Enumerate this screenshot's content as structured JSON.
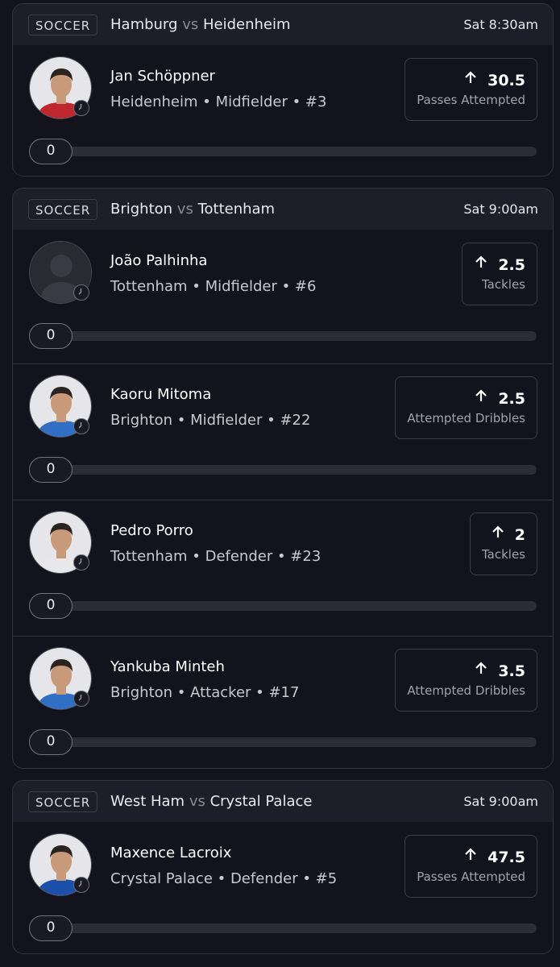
{
  "games": [
    {
      "sport": "SOCCER",
      "home": "Hamburg",
      "vs": "vs",
      "away": "Heidenheim",
      "time": "Sat 8:30am",
      "players": [
        {
          "name": "Jan Schöppner",
          "team": "Heidenheim",
          "position": "Midfielder",
          "number": "#3",
          "meta": "Heidenheim • Midfielder • #3",
          "line": "30.5",
          "stat": "Passes Attempted",
          "count": "0",
          "progress": 0,
          "jersey": "#c0262d",
          "photo": "player-photo"
        }
      ]
    },
    {
      "sport": "SOCCER",
      "home": "Brighton",
      "vs": "vs",
      "away": "Tottenham",
      "time": "Sat 9:00am",
      "players": [
        {
          "name": "João Palhinha",
          "team": "Tottenham",
          "position": "Midfielder",
          "number": "#6",
          "meta": "Tottenham • Midfielder • #6",
          "line": "2.5",
          "stat": "Tackles",
          "count": "0",
          "progress": 0,
          "jersey": "#2a2a33",
          "photo": "silhouette-placeholder"
        },
        {
          "name": "Kaoru Mitoma",
          "team": "Brighton",
          "position": "Midfielder",
          "number": "#22",
          "meta": "Brighton • Midfielder • #22",
          "line": "2.5",
          "stat": "Attempted Dribbles",
          "count": "0",
          "progress": 0,
          "jersey": "#2f6fc4",
          "photo": "player-photo"
        },
        {
          "name": "Pedro Porro",
          "team": "Tottenham",
          "position": "Defender",
          "number": "#23",
          "meta": "Tottenham • Defender • #23",
          "line": "2",
          "stat": "Tackles",
          "count": "0",
          "progress": 0,
          "jersey": "#e8e8ea",
          "photo": "player-photo"
        },
        {
          "name": "Yankuba Minteh",
          "team": "Brighton",
          "position": "Attacker",
          "number": "#17",
          "meta": "Brighton • Attacker • #17",
          "line": "3.5",
          "stat": "Attempted Dribbles",
          "count": "0",
          "progress": 0,
          "jersey": "#2f6fc4",
          "photo": "player-photo"
        }
      ]
    },
    {
      "sport": "SOCCER",
      "home": "West Ham",
      "vs": "vs",
      "away": "Crystal Palace",
      "time": "Sat 9:00am",
      "players": [
        {
          "name": "Maxence Lacroix",
          "team": "Crystal Palace",
          "position": "Defender",
          "number": "#5",
          "meta": "Crystal Palace • Defender • #5",
          "line": "47.5",
          "stat": "Passes Attempted",
          "count": "0",
          "progress": 0,
          "jersey": "#1b4fa8",
          "photo": "player-photo"
        }
      ]
    }
  ],
  "icons": {
    "stat_arrow": "arrow-up-icon",
    "status": "clock-icon"
  },
  "colors": {
    "background": "#13131d",
    "header": "#1e1e2a",
    "border": "#34343f",
    "track": "#2c2c38"
  }
}
